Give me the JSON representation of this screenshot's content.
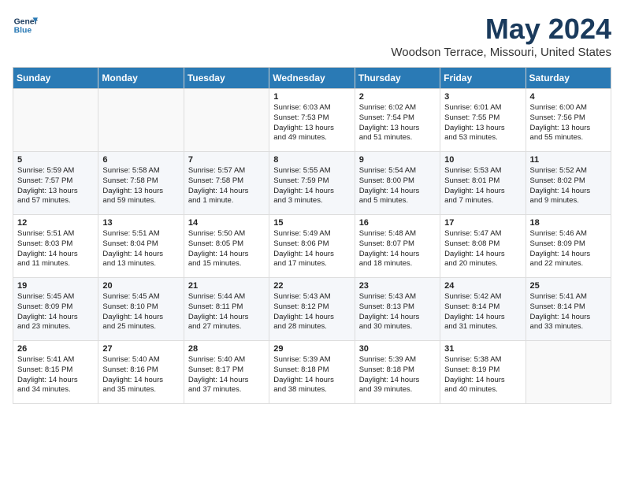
{
  "header": {
    "logo_line1": "General",
    "logo_line2": "Blue",
    "month": "May 2024",
    "location": "Woodson Terrace, Missouri, United States"
  },
  "days_of_week": [
    "Sunday",
    "Monday",
    "Tuesday",
    "Wednesday",
    "Thursday",
    "Friday",
    "Saturday"
  ],
  "weeks": [
    [
      {
        "day": "",
        "info": ""
      },
      {
        "day": "",
        "info": ""
      },
      {
        "day": "",
        "info": ""
      },
      {
        "day": "1",
        "info": "Sunrise: 6:03 AM\nSunset: 7:53 PM\nDaylight: 13 hours\nand 49 minutes."
      },
      {
        "day": "2",
        "info": "Sunrise: 6:02 AM\nSunset: 7:54 PM\nDaylight: 13 hours\nand 51 minutes."
      },
      {
        "day": "3",
        "info": "Sunrise: 6:01 AM\nSunset: 7:55 PM\nDaylight: 13 hours\nand 53 minutes."
      },
      {
        "day": "4",
        "info": "Sunrise: 6:00 AM\nSunset: 7:56 PM\nDaylight: 13 hours\nand 55 minutes."
      }
    ],
    [
      {
        "day": "5",
        "info": "Sunrise: 5:59 AM\nSunset: 7:57 PM\nDaylight: 13 hours\nand 57 minutes."
      },
      {
        "day": "6",
        "info": "Sunrise: 5:58 AM\nSunset: 7:58 PM\nDaylight: 13 hours\nand 59 minutes."
      },
      {
        "day": "7",
        "info": "Sunrise: 5:57 AM\nSunset: 7:58 PM\nDaylight: 14 hours\nand 1 minute."
      },
      {
        "day": "8",
        "info": "Sunrise: 5:55 AM\nSunset: 7:59 PM\nDaylight: 14 hours\nand 3 minutes."
      },
      {
        "day": "9",
        "info": "Sunrise: 5:54 AM\nSunset: 8:00 PM\nDaylight: 14 hours\nand 5 minutes."
      },
      {
        "day": "10",
        "info": "Sunrise: 5:53 AM\nSunset: 8:01 PM\nDaylight: 14 hours\nand 7 minutes."
      },
      {
        "day": "11",
        "info": "Sunrise: 5:52 AM\nSunset: 8:02 PM\nDaylight: 14 hours\nand 9 minutes."
      }
    ],
    [
      {
        "day": "12",
        "info": "Sunrise: 5:51 AM\nSunset: 8:03 PM\nDaylight: 14 hours\nand 11 minutes."
      },
      {
        "day": "13",
        "info": "Sunrise: 5:51 AM\nSunset: 8:04 PM\nDaylight: 14 hours\nand 13 minutes."
      },
      {
        "day": "14",
        "info": "Sunrise: 5:50 AM\nSunset: 8:05 PM\nDaylight: 14 hours\nand 15 minutes."
      },
      {
        "day": "15",
        "info": "Sunrise: 5:49 AM\nSunset: 8:06 PM\nDaylight: 14 hours\nand 17 minutes."
      },
      {
        "day": "16",
        "info": "Sunrise: 5:48 AM\nSunset: 8:07 PM\nDaylight: 14 hours\nand 18 minutes."
      },
      {
        "day": "17",
        "info": "Sunrise: 5:47 AM\nSunset: 8:08 PM\nDaylight: 14 hours\nand 20 minutes."
      },
      {
        "day": "18",
        "info": "Sunrise: 5:46 AM\nSunset: 8:09 PM\nDaylight: 14 hours\nand 22 minutes."
      }
    ],
    [
      {
        "day": "19",
        "info": "Sunrise: 5:45 AM\nSunset: 8:09 PM\nDaylight: 14 hours\nand 23 minutes."
      },
      {
        "day": "20",
        "info": "Sunrise: 5:45 AM\nSunset: 8:10 PM\nDaylight: 14 hours\nand 25 minutes."
      },
      {
        "day": "21",
        "info": "Sunrise: 5:44 AM\nSunset: 8:11 PM\nDaylight: 14 hours\nand 27 minutes."
      },
      {
        "day": "22",
        "info": "Sunrise: 5:43 AM\nSunset: 8:12 PM\nDaylight: 14 hours\nand 28 minutes."
      },
      {
        "day": "23",
        "info": "Sunrise: 5:43 AM\nSunset: 8:13 PM\nDaylight: 14 hours\nand 30 minutes."
      },
      {
        "day": "24",
        "info": "Sunrise: 5:42 AM\nSunset: 8:14 PM\nDaylight: 14 hours\nand 31 minutes."
      },
      {
        "day": "25",
        "info": "Sunrise: 5:41 AM\nSunset: 8:14 PM\nDaylight: 14 hours\nand 33 minutes."
      }
    ],
    [
      {
        "day": "26",
        "info": "Sunrise: 5:41 AM\nSunset: 8:15 PM\nDaylight: 14 hours\nand 34 minutes."
      },
      {
        "day": "27",
        "info": "Sunrise: 5:40 AM\nSunset: 8:16 PM\nDaylight: 14 hours\nand 35 minutes."
      },
      {
        "day": "28",
        "info": "Sunrise: 5:40 AM\nSunset: 8:17 PM\nDaylight: 14 hours\nand 37 minutes."
      },
      {
        "day": "29",
        "info": "Sunrise: 5:39 AM\nSunset: 8:18 PM\nDaylight: 14 hours\nand 38 minutes."
      },
      {
        "day": "30",
        "info": "Sunrise: 5:39 AM\nSunset: 8:18 PM\nDaylight: 14 hours\nand 39 minutes."
      },
      {
        "day": "31",
        "info": "Sunrise: 5:38 AM\nSunset: 8:19 PM\nDaylight: 14 hours\nand 40 minutes."
      },
      {
        "day": "",
        "info": ""
      }
    ]
  ]
}
